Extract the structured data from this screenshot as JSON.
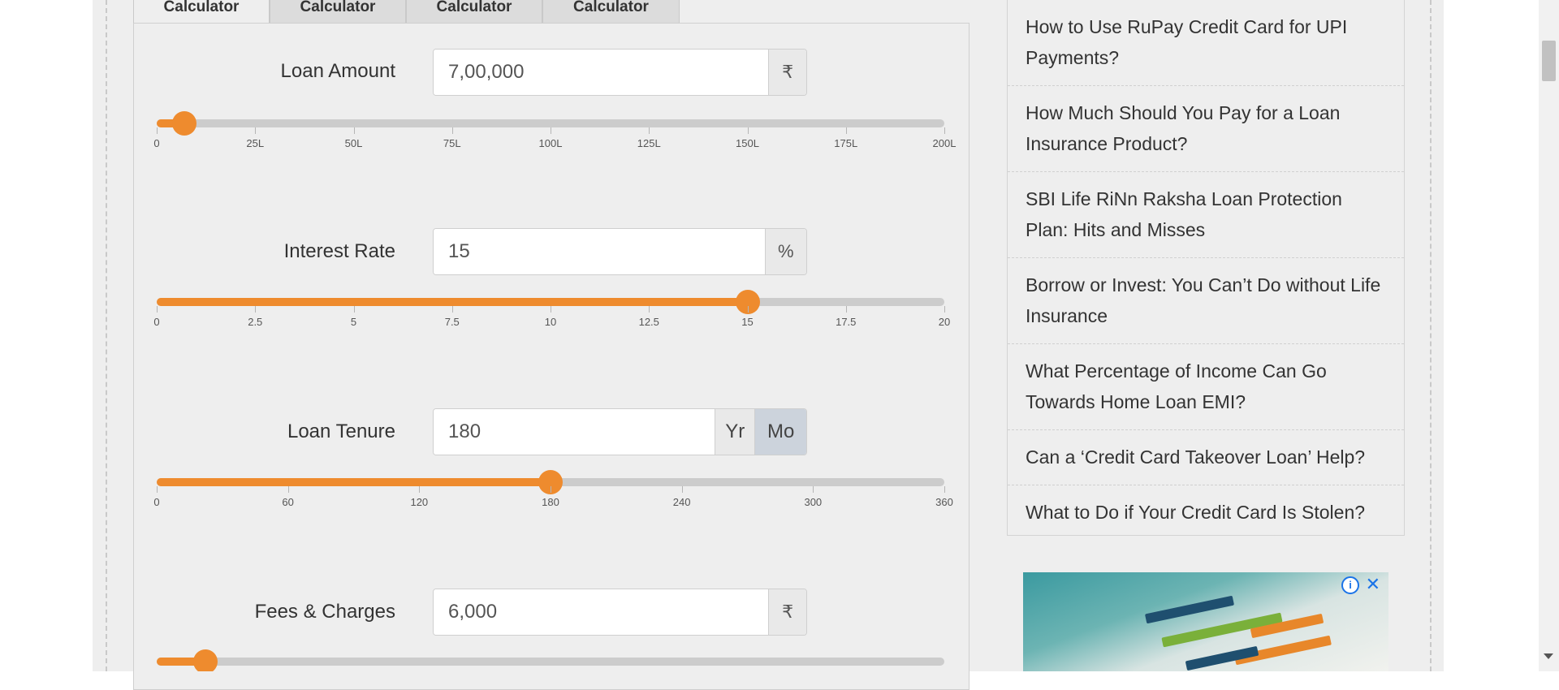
{
  "tabs": [
    "Calculator",
    "Calculator",
    "Calculator",
    "Calculator"
  ],
  "fields": {
    "loan_amount": {
      "label": "Loan Amount",
      "value": "7,00,000",
      "unit": "₹",
      "slider_value": 7,
      "slider_max": 200,
      "ticks": [
        "0",
        "25L",
        "50L",
        "75L",
        "100L",
        "125L",
        "150L",
        "175L",
        "200L"
      ]
    },
    "interest_rate": {
      "label": "Interest Rate",
      "value": "15",
      "unit": "%",
      "slider_value": 15,
      "slider_max": 20,
      "ticks": [
        "0",
        "2.5",
        "5",
        "7.5",
        "10",
        "12.5",
        "15",
        "17.5",
        "20"
      ]
    },
    "loan_tenure": {
      "label": "Loan Tenure",
      "value": "180",
      "unit_year": "Yr",
      "unit_month": "Mo",
      "selected_unit": "Mo",
      "slider_value": 180,
      "slider_max": 360,
      "ticks": [
        "0",
        "60",
        "120",
        "180",
        "240",
        "300",
        "360"
      ]
    },
    "fees_charges": {
      "label": "Fees & Charges",
      "value": "6,000",
      "unit": "₹",
      "slider_value_fraction": 0.062
    }
  },
  "sidebar": {
    "articles": [
      "How to Use RuPay Credit Card for UPI Payments?",
      "How Much Should You Pay for a Loan Insurance Product?",
      "SBI Life RiNn Raksha Loan Protection Plan: Hits and Misses",
      "Borrow or Invest: You Can’t Do without Life Insurance",
      "What Percentage of Income Can Go Towards Home Loan EMI?",
      "Can a ‘Credit Card Takeover Loan’ Help?",
      "What to Do if Your Credit Card Is Stolen?"
    ]
  },
  "ad": {
    "info_icon": "info-icon",
    "close_icon": "close-icon"
  },
  "colors": {
    "accent": "#ee8b2e",
    "track": "#cccccc",
    "background": "#eeeeee"
  }
}
